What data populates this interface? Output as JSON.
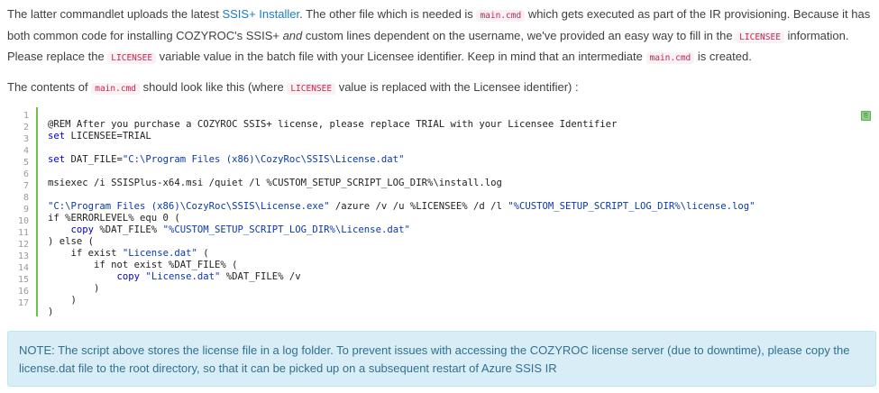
{
  "intro": {
    "p1_a": "The latter commandlet uploads the latest ",
    "p1_link": "SSIS+ Installer",
    "p1_b": ". The other file which is needed is ",
    "p1_code1": "main.cmd",
    "p1_c": " which gets executed as part of the IR provisioning. Because it has both common code for installing COZYROC's SSIS+ ",
    "p1_em": "and",
    "p1_d": " custom lines dependent on the username, we've provided an easy way to fill in the ",
    "p1_code2": "LICENSEE",
    "p1_e": " information. Please replace the ",
    "p1_code3": "LICENSEE",
    "p1_f": " variable value in the batch file with your Licensee identifier. Keep in mind that an intermediate ",
    "p1_code4": "main.cmd",
    "p1_g": " is created.",
    "p2_a": "The contents of ",
    "p2_code1": "main.cmd",
    "p2_b": " should look like this (where ",
    "p2_code2": "LICENSEE",
    "p2_c": " value is replaced with the Licensee identifier) :"
  },
  "code_block": {
    "line_numbers": [
      "1",
      "2",
      "3",
      "4",
      "5",
      "6",
      "7",
      "8",
      "9",
      "10",
      "11",
      "12",
      "13",
      "14",
      "15",
      "16",
      "17"
    ],
    "lines": [
      "@REM After you purchase a COZYROC SSIS+ license, please replace TRIAL with your Licensee Identifier",
      "set LICENSEE=TRIAL",
      "",
      "set DAT_FILE=\"C:\\Program Files (x86)\\CozyRoc\\SSIS\\License.dat\"",
      "",
      "msiexec /i SSISPlus-x64.msi /quiet /l %CUSTOM_SETUP_SCRIPT_LOG_DIR%\\install.log",
      "",
      "\"C:\\Program Files (x86)\\CozyRoc\\SSIS\\License.exe\" /azure /v /u %LICENSEE% /d /l \"%CUSTOM_SETUP_SCRIPT_LOG_DIR%\\license.log\"",
      "if %ERRORLEVEL% equ 0 (",
      "    copy %DAT_FILE% \"%CUSTOM_SETUP_SCRIPT_LOG_DIR%\\License.dat\"",
      ") else (",
      "    if exist \"License.dat\" (",
      "        if not exist %DAT_FILE% (",
      "            copy \"License.dat\" %DAT_FILE% /v",
      "        )",
      "    )",
      ")"
    ],
    "copy_icon": "copy-icon",
    "gutter_color": "#6fbf4a"
  },
  "note": {
    "text": "NOTE: The script above stores the license file in a log folder. To prevent issues with accessing the COZYROC license server (due to downtime), please copy the license.dat file to the root directory, so that it can be picked up on a subsequent restart of Azure SSIS IR",
    "background": "#d9edf7",
    "color": "#31708f"
  }
}
